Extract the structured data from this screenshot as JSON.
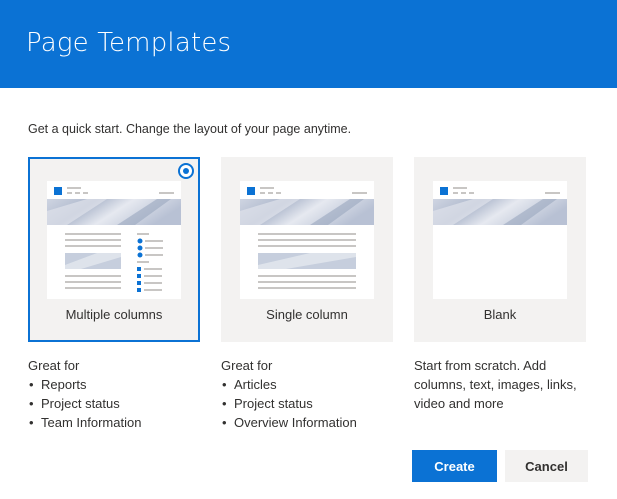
{
  "header": {
    "title": "Page Templates"
  },
  "subtitle": "Get a quick start. Change the layout of your page anytime.",
  "colors": {
    "accent": "#0b72d4",
    "card_bg": "#f3f2f1"
  },
  "templates": [
    {
      "label": "Multiple columns",
      "selected": true,
      "description_heading": "Great for",
      "bullets": [
        "Reports",
        "Project status",
        "Team Information"
      ]
    },
    {
      "label": "Single column",
      "selected": false,
      "description_heading": "Great for",
      "bullets": [
        "Articles",
        "Project status",
        "Overview Information"
      ]
    },
    {
      "label": "Blank",
      "selected": false,
      "description_lines": [
        "Start from scratch. Add",
        "columns, text, images, links,",
        "video and more"
      ]
    }
  ],
  "buttons": {
    "create": "Create",
    "cancel": "Cancel"
  }
}
